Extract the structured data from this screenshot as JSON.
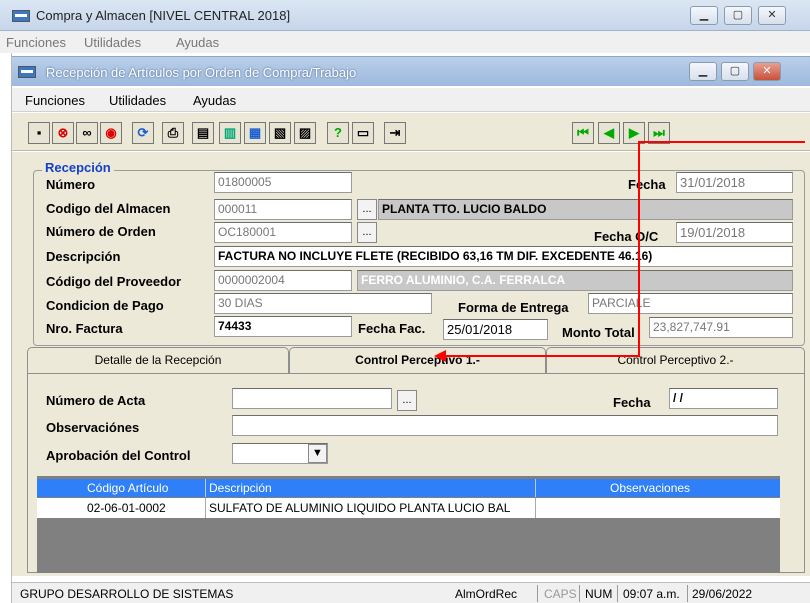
{
  "outer_window": {
    "title": "Compra y Almacen [NIVEL CENTRAL 2018]",
    "menu": [
      "Funciones",
      "Utilidades",
      "Ayudas"
    ]
  },
  "inner_window": {
    "title": "Recepción de Artículos por Orden de Compra/Trabajo",
    "menu": [
      "Funciones",
      "Utilidades",
      "Ayudas"
    ]
  },
  "recepcion": {
    "legend": "Recepción",
    "numero_label": "Número",
    "numero": "01800005",
    "fecha_label": "Fecha",
    "fecha": "31/01/2018",
    "almacen_label": "Codigo del Almacen",
    "almacen_code": "000011",
    "almacen_name": "PLANTA TTO. LUCIO BALDO",
    "orden_label": "Número de Orden",
    "orden": "OC180001",
    "fecha_oc_label": "Fecha O/C",
    "fecha_oc": "19/01/2018",
    "descripcion_label": "Descripción",
    "descripcion": "FACTURA NO INCLUYE FLETE (RECIBIDO 63,16 TM DIF. EXCEDENTE 46.16)",
    "proveedor_label": "Código del  Proveedor",
    "proveedor_code": "0000002004",
    "proveedor_name": "FERRO ALUMINIO, C.A. FERRALCA",
    "pago_label": "Condicion de Pago",
    "pago": "30 DIAS",
    "entrega_label": "Forma de Entrega",
    "entrega": "PARCIALE",
    "factura_label": "Nro. Factura",
    "factura": "74433",
    "fecha_fac_label": "Fecha Fac.",
    "fecha_fac": "25/01/2018",
    "monto_label": "Monto Total",
    "monto": "23,827,747.91",
    "dots": "..."
  },
  "tabs": [
    "Detalle de la Recepción",
    "Control Perceptivo 1.-",
    "Control Perceptivo 2.-"
  ],
  "control": {
    "acta_label": "Número de Acta",
    "acta": "",
    "fecha_label": "Fecha",
    "fecha": " / /",
    "obs_label": "Observaciónes",
    "obs": "",
    "aprob_label": "Aprobación del Control",
    "aprob": ""
  },
  "grid": {
    "headers": [
      "Código Artículo",
      "Descripción",
      "Observaciones"
    ],
    "rows": [
      {
        "codigo": "02-06-01-0002",
        "descripcion": "SULFATO DE ALUMINIO LIQUIDO PLANTA LUCIO BAL",
        "obs": ""
      }
    ]
  },
  "status": {
    "left": "GRUPO DESARROLLO DE SISTEMAS",
    "module": "AlmOrdRec",
    "caps": "CAPS",
    "num": "NUM",
    "time": "09:07 a.m.",
    "date": "29/06/2022"
  },
  "colors": {
    "accent": "#1540c8",
    "grid_header": "#2f7ff8",
    "annotation_arrow": "#ff0000"
  }
}
